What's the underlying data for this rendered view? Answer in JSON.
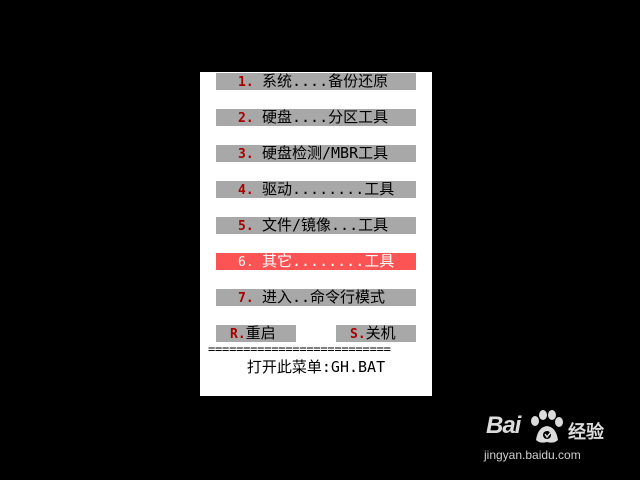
{
  "menu": {
    "items": [
      {
        "key": "1.",
        "label": "系统....备份还原",
        "selected": false
      },
      {
        "key": "2.",
        "label": "硬盘....分区工具",
        "selected": false
      },
      {
        "key": "3.",
        "label": "硬盘检测/MBR工具",
        "selected": false
      },
      {
        "key": "4.",
        "label": "驱动........工具",
        "selected": false
      },
      {
        "key": "5.",
        "label": "文件/镜像...工具",
        "selected": false
      },
      {
        "key": "6.",
        "label": "其它........工具",
        "selected": true
      },
      {
        "key": "7.",
        "label": "进入..命令行模式",
        "selected": false
      }
    ],
    "reboot": {
      "key": "R.",
      "label": "重启"
    },
    "shutdown": {
      "key": "S.",
      "label": "关机"
    },
    "separator": "==========================",
    "footer": "打开此菜单:GH.BAT"
  },
  "watermark": {
    "logo": "Bai",
    "brand": "经验",
    "url": "jingyan.baidu.com"
  },
  "colors": {
    "background": "#000000",
    "panel": "#ffffff",
    "item": "#a8a8a8",
    "selected": "#fc5454",
    "hotkey": "#a80000"
  }
}
